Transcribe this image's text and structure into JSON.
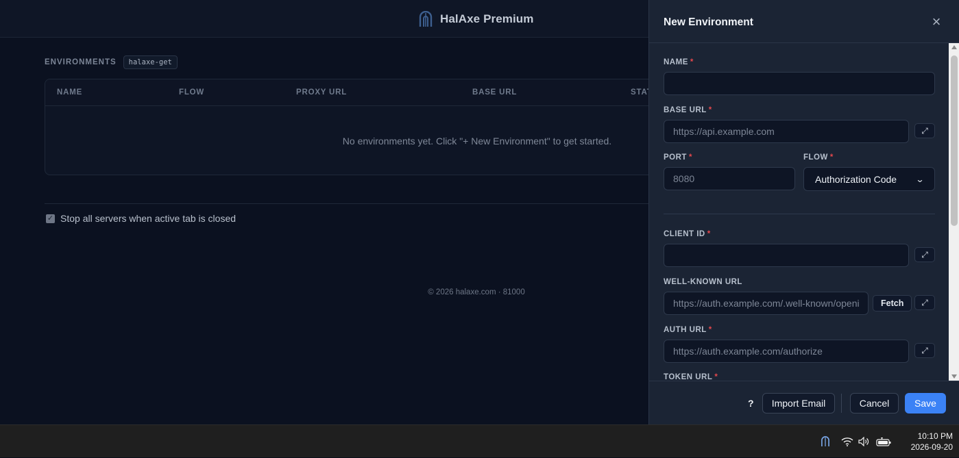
{
  "app": {
    "title": "HalAxe Premium",
    "environments_label": "ENVIRONMENTS",
    "environments_tag": "halaxe-get",
    "table": {
      "columns": [
        "NAME",
        "FLOW",
        "PROXY URL",
        "BASE URL",
        "STAT"
      ],
      "empty_message": "No environments yet. Click \"+ New Environment\" to get started."
    },
    "stop_servers_label": "Stop all servers when active tab is closed",
    "stop_servers_checked": true,
    "footer": "© 2026 halaxe.com · 81000"
  },
  "panel": {
    "title": "New Environment",
    "close_icon": "close-icon",
    "fields": {
      "name": {
        "label": "NAME",
        "required": "*",
        "value": "",
        "placeholder": ""
      },
      "base_url": {
        "label": "BASE URL",
        "required": "*",
        "value": "",
        "placeholder": "https://api.example.com"
      },
      "port": {
        "label": "PORT",
        "required": "*",
        "value": "",
        "placeholder": "8080"
      },
      "flow": {
        "label": "FLOW",
        "required": "*",
        "selected": "Authorization Code"
      },
      "client_id": {
        "label": "CLIENT ID",
        "required": "*",
        "value": "",
        "placeholder": ""
      },
      "well_known_url": {
        "label": "WELL-KNOWN URL",
        "value": "",
        "placeholder": "https://auth.example.com/.well-known/openid",
        "fetch_label": "Fetch"
      },
      "auth_url": {
        "label": "AUTH URL",
        "required": "*",
        "value": "",
        "placeholder": "https://auth.example.com/authorize"
      },
      "token_url": {
        "label": "TOKEN URL",
        "required": "*"
      }
    },
    "expand_icon": "expand-icon",
    "footer": {
      "help_label": "?",
      "import_label": "Import Email",
      "cancel_label": "Cancel",
      "save_label": "Save"
    }
  },
  "taskbar": {
    "time": "10:10 PM",
    "date": "2026-09-20",
    "tray_icons": [
      "halaxe-tray-icon",
      "wifi-icon",
      "volume-icon",
      "battery-icon"
    ]
  },
  "colors": {
    "accent": "#3b82f6",
    "required": "#e5484d",
    "panel_bg": "#1b2434",
    "app_bg": "#0b1120"
  }
}
